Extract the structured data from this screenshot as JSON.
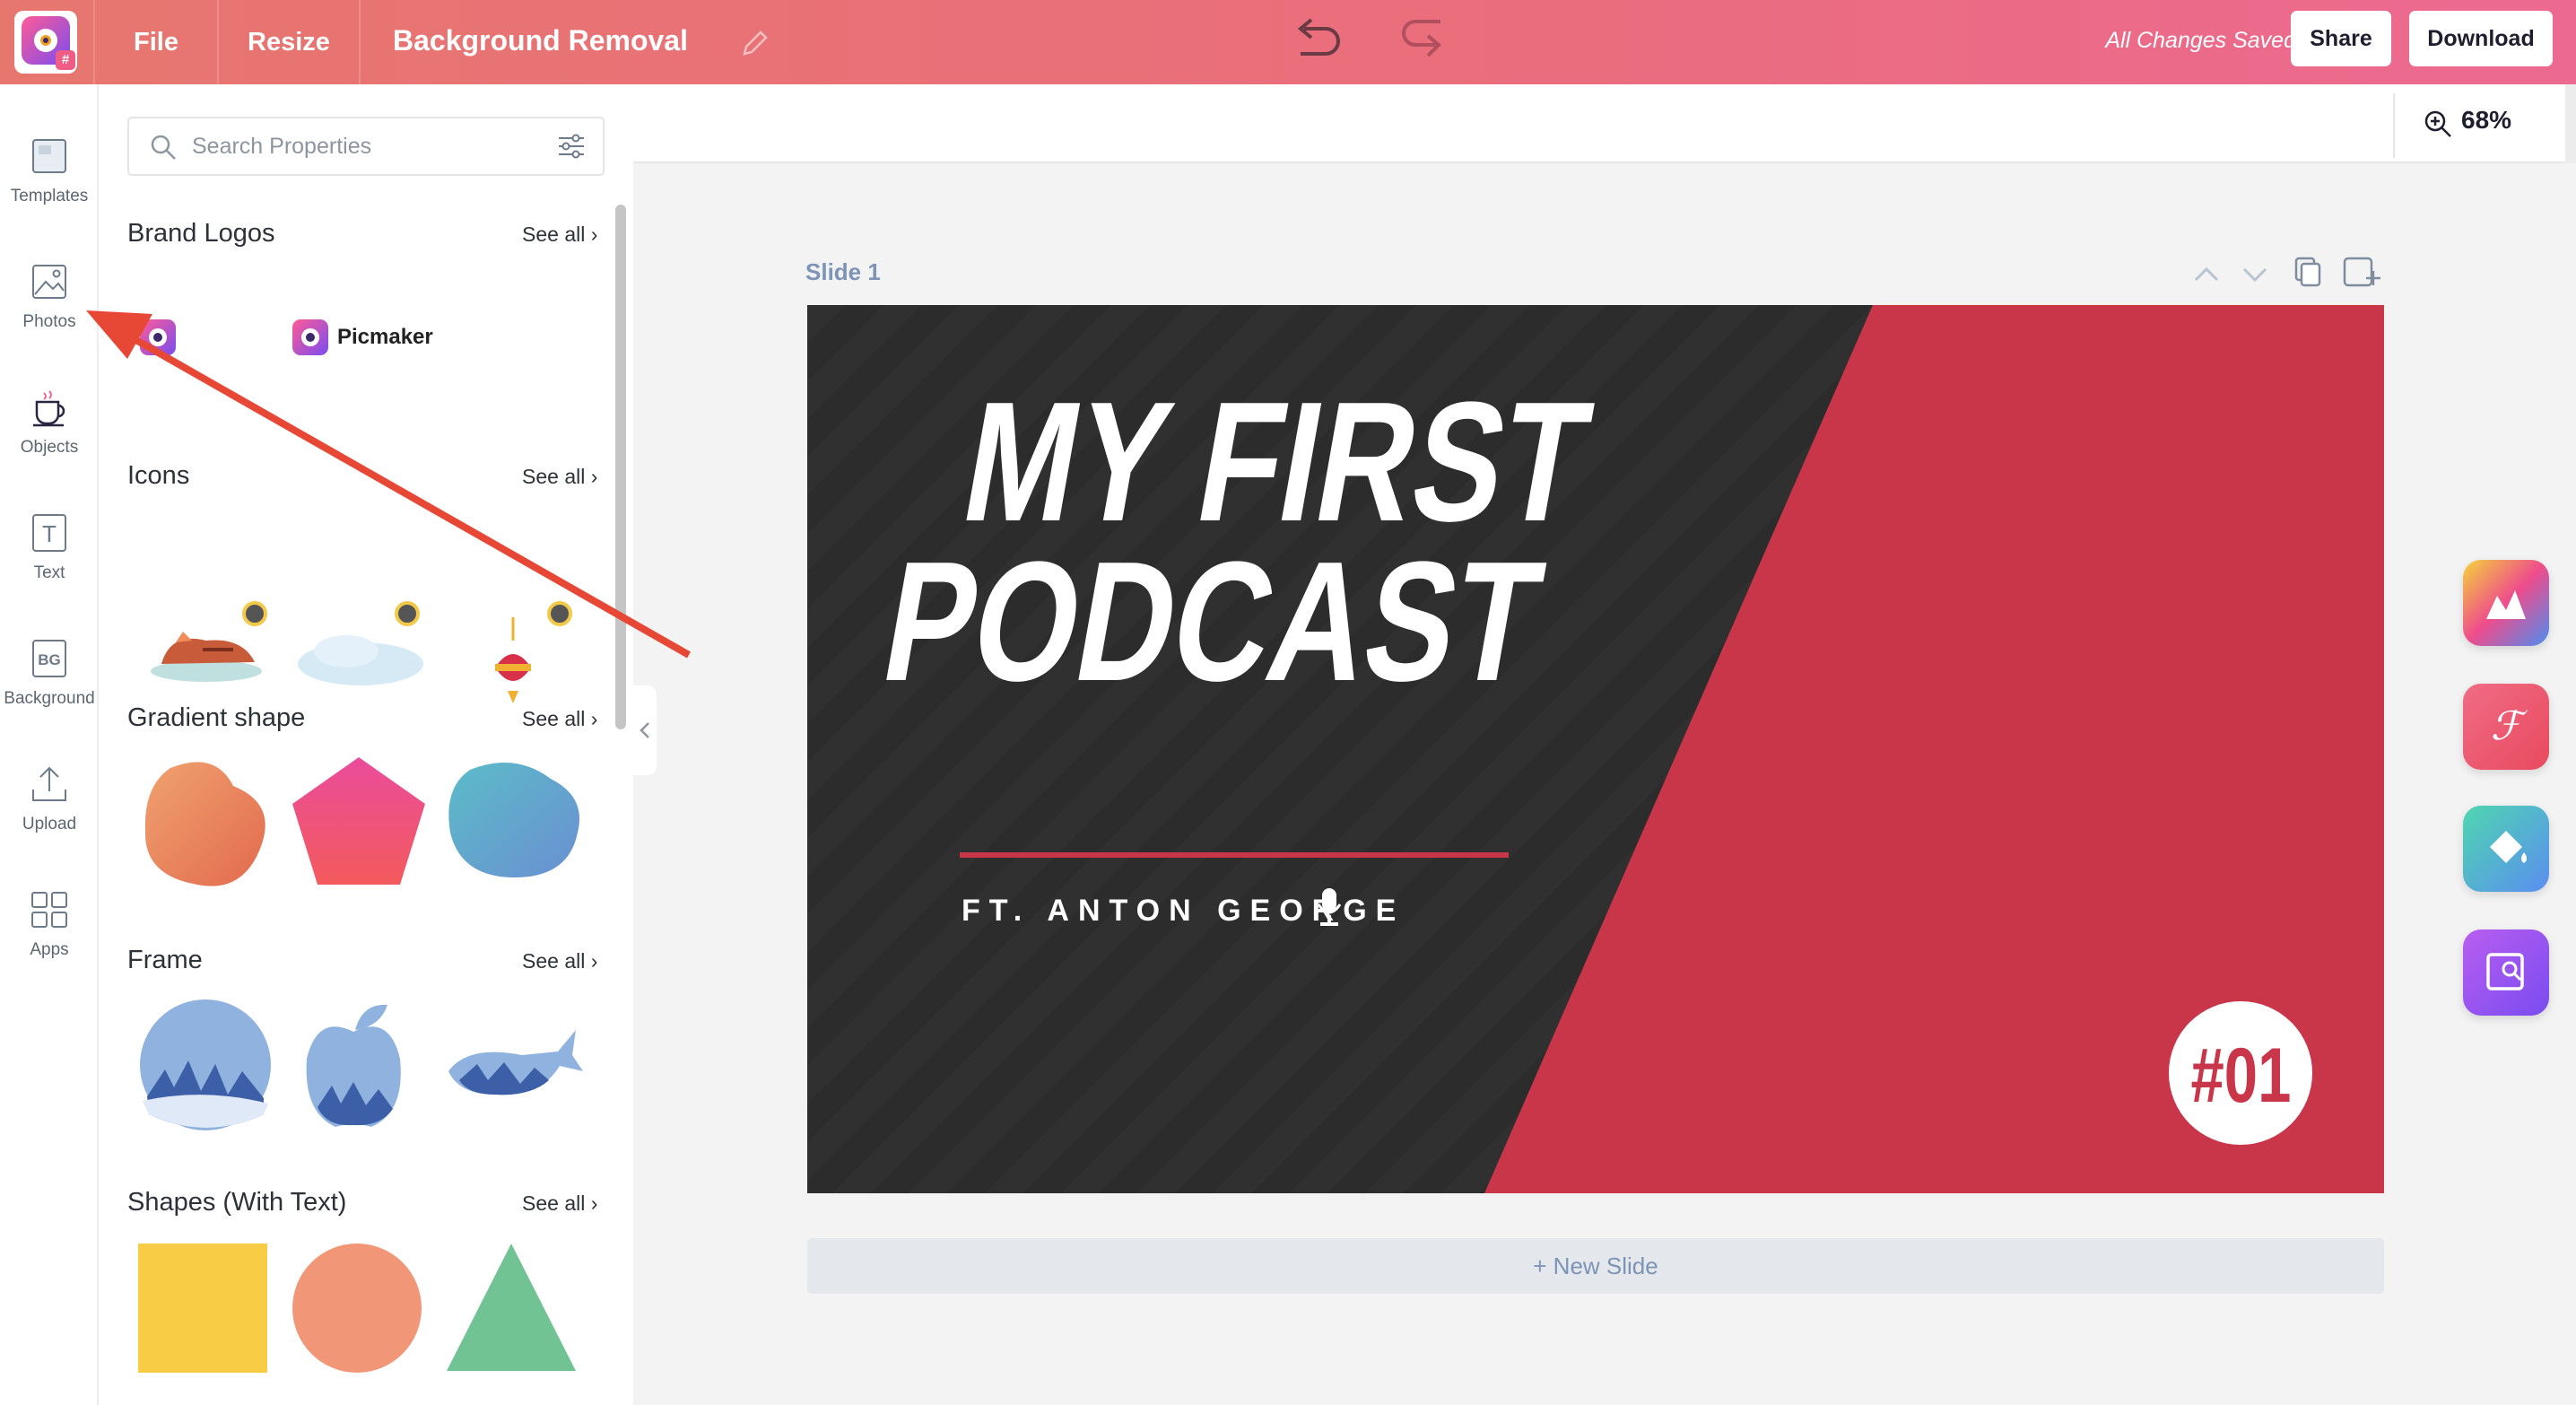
{
  "topbar": {
    "menu": [
      "File",
      "Resize"
    ],
    "title": "Background Removal",
    "status": "All Changes Saved",
    "share_label": "Share",
    "download_label": "Download"
  },
  "sidebar": {
    "items": [
      {
        "label": "Templates",
        "icon": "templates-icon"
      },
      {
        "label": "Photos",
        "icon": "photos-icon"
      },
      {
        "label": "Objects",
        "icon": "objects-icon"
      },
      {
        "label": "Text",
        "icon": "text-icon"
      },
      {
        "label": "Background",
        "icon": "background-icon"
      },
      {
        "label": "Upload",
        "icon": "upload-icon"
      },
      {
        "label": "Apps",
        "icon": "apps-icon"
      }
    ],
    "bg_icon_text": "BG",
    "text_icon_text": "T"
  },
  "panel": {
    "search_placeholder": "Search Properties",
    "see_all": "See all",
    "sections": [
      {
        "title": "Brand Logos"
      },
      {
        "title": "Icons"
      },
      {
        "title": "Gradient shape"
      },
      {
        "title": "Frame"
      },
      {
        "title": "Shapes (With Text)"
      }
    ],
    "brand_logo_text": "Picmaker"
  },
  "canvas": {
    "zoom": "68%",
    "slide_label": "Slide 1",
    "new_slide": "+ New Slide"
  },
  "slide": {
    "title_line1": "MY FIRST",
    "title_line2": "PODCAST",
    "subtitle": "FT. ANTON GEORGE",
    "badge": "#01"
  },
  "colors": {
    "topbar_start": "#e7766f",
    "topbar_end": "#ec6991",
    "slide_dark": "#2c2c2c",
    "slide_red": "#c9364a",
    "arrow": "#e74836",
    "shape_yellow": "#f8cc45",
    "shape_salmon": "#f19677",
    "shape_green": "#72c394"
  },
  "right_apps": [
    "image-app-icon",
    "font-app-icon",
    "paint-bucket-icon",
    "image-search-icon"
  ]
}
